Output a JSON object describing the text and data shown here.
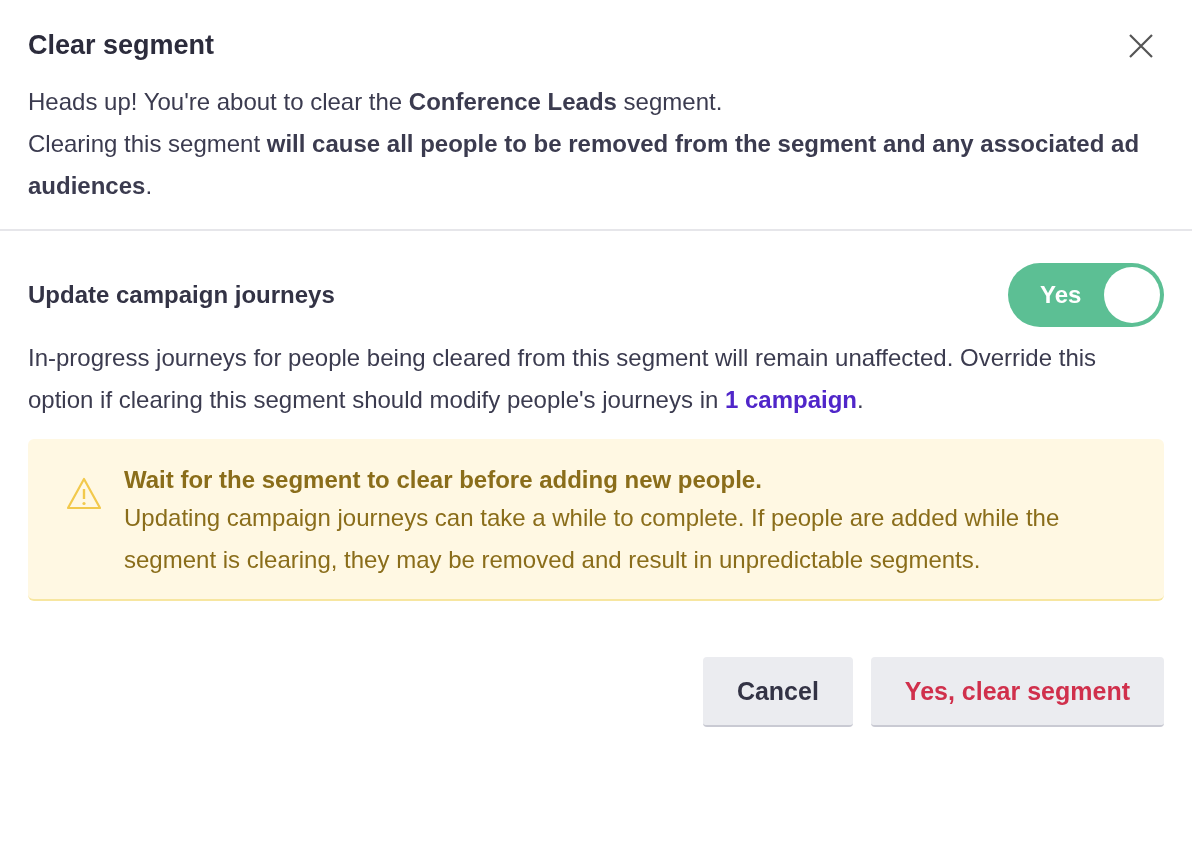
{
  "dialog": {
    "title": "Clear segment"
  },
  "intro": [
    "Heads up! You're about to clear the **Conference Leads** segment.",
    "Clearing this segment **will cause all people to be removed from the segment and any associated ad audiences**."
  ],
  "option": {
    "label": "Update campaign journeys",
    "toggle": {
      "on": true,
      "label": "Yes"
    },
    "description": {
      "before": "In-progress journeys for people being cleared from this segment will remain unaffected. Override this option if clearing this segment should modify people's journeys in ",
      "link": "1 campaign",
      "after": "."
    }
  },
  "warning": {
    "title": "Wait for the segment to clear before adding new people.",
    "body": "Updating campaign journeys can take a while to complete. If people are added while the segment is clearing, they may be removed and result in unpredictable segments."
  },
  "buttons": [
    {
      "label": "Cancel",
      "kind": "secondary"
    },
    {
      "label": "Yes, clear segment",
      "kind": "danger"
    }
  ]
}
